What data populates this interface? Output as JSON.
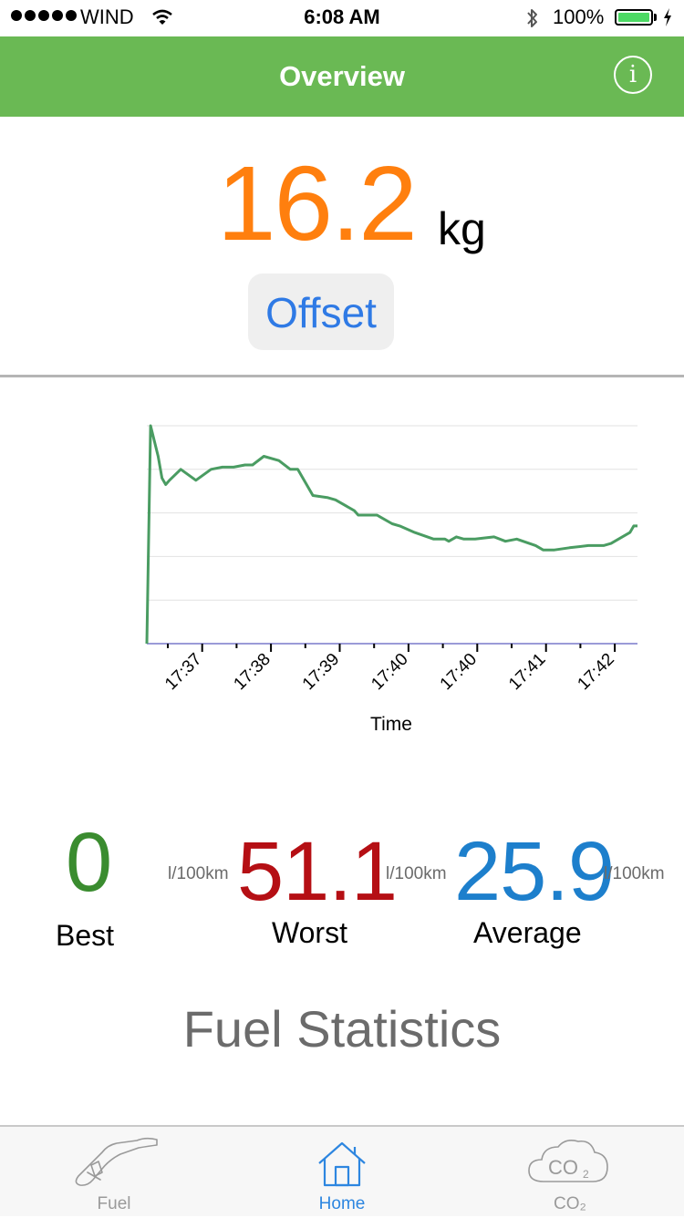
{
  "status_bar": {
    "carrier": "WIND",
    "time": "6:08 AM",
    "battery_percent": "100%",
    "battery_level": 1.0,
    "icons": [
      "signal-dots-icon",
      "wifi-icon",
      "bluetooth-icon",
      "battery-icon",
      "charging-bolt-icon"
    ]
  },
  "nav": {
    "title": "Overview",
    "info_icon": "info-icon"
  },
  "summary": {
    "value": "16.2",
    "unit": "kg",
    "offset_label": "Offset"
  },
  "chart_data": {
    "type": "line",
    "title": "",
    "xlabel": "Time",
    "ylabel": "",
    "x_tick_labels": [
      "17:37",
      "17:38",
      "17:39",
      "17:40",
      "17:40",
      "17:41",
      "17:42"
    ],
    "grid": "horizontal",
    "y_axis_labels_shown": false,
    "ylim": [
      0,
      100
    ],
    "series": [
      {
        "color": "#4a9c62",
        "x": [
          0,
          1,
          3,
          4,
          5,
          6,
          9,
          13,
          17,
          20,
          23,
          26,
          28,
          31,
          35,
          38,
          40,
          44,
          48,
          50,
          55,
          56,
          61,
          62,
          65,
          67,
          71,
          76,
          79,
          80,
          82,
          84,
          86,
          87,
          92,
          95,
          98,
          103,
          105,
          107,
          108,
          112,
          117,
          121,
          123,
          128,
          129,
          130
        ],
        "y": [
          0,
          100,
          86,
          76,
          73,
          75,
          80,
          75,
          80,
          81,
          81,
          82,
          82,
          86,
          84,
          80,
          80,
          68,
          67,
          66,
          61,
          59,
          59,
          58,
          55,
          54,
          51,
          48,
          48,
          47,
          49,
          48,
          48,
          48,
          49,
          47,
          48,
          45,
          43,
          43,
          43,
          44,
          45,
          45,
          46,
          51,
          54,
          54
        ]
      }
    ]
  },
  "stats": {
    "best": {
      "value": "0",
      "label": "Best"
    },
    "worst": {
      "value": "51.1",
      "unit": "l/100km",
      "label": "Worst"
    },
    "average": {
      "value": "25.9",
      "unit": "l/100km",
      "label": "Average"
    },
    "best_unit": "l/100km",
    "title": "Fuel Statistics"
  },
  "tabs": [
    {
      "label": "Fuel",
      "icon": "fuel-nozzle-icon",
      "active": false
    },
    {
      "label": "Home",
      "icon": "home-icon",
      "active": true
    },
    {
      "label": "CO₂",
      "icon": "co2-cloud-icon",
      "active": false
    }
  ],
  "colors": {
    "nav_green": "#6ab954",
    "value_orange": "#ff7f0e",
    "offset_blue": "#2f7ae5",
    "best_green": "#3a8c2f",
    "worst_red": "#b50f14",
    "average_blue": "#1d7fcc",
    "tab_active": "#2d86e0",
    "tab_inactive": "#9a9a9a",
    "chart_line": "#4a9c62",
    "axis_purple": "#7a7acb"
  }
}
